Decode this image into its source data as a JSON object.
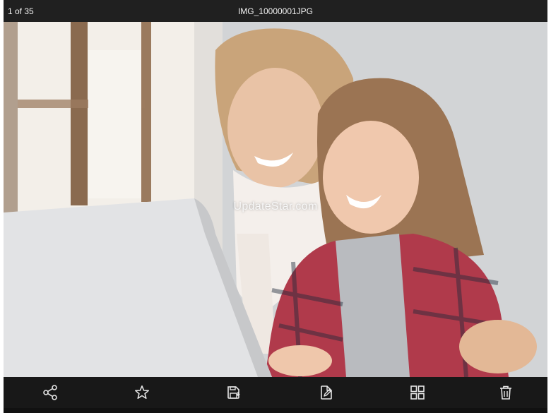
{
  "header": {
    "counter": "1 of 35",
    "filename": "IMG_10000001JPG"
  },
  "photo": {
    "watermark": "UpdateStar.com"
  },
  "toolbar": {
    "icons": [
      "share-icon",
      "star-icon",
      "save-icon",
      "edit-icon",
      "grid-icon",
      "trash-icon"
    ]
  },
  "colors": {
    "bar_background": "#202020",
    "text": "#f1f1f1",
    "icon": "#e6e6e6"
  }
}
